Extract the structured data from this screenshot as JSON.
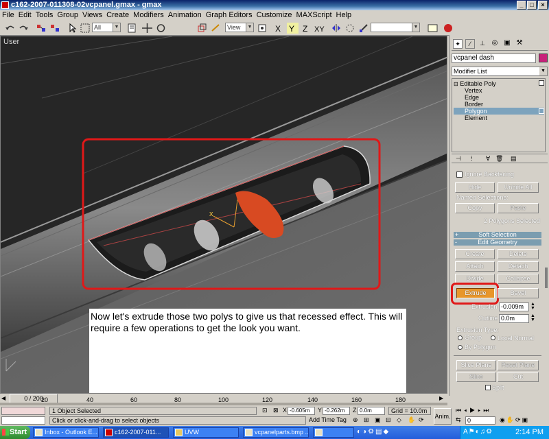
{
  "window": {
    "title": "c162-2007-011308-02vcpanel.gmax - gmax",
    "buttons": [
      "_",
      "□",
      "×"
    ]
  },
  "menu": [
    "File",
    "Edit",
    "Tools",
    "Group",
    "Views",
    "Create",
    "Modifiers",
    "Animation",
    "Graph Editors",
    "Customize",
    "MAXScript",
    "Help"
  ],
  "toolbar": {
    "selection_filter": "All",
    "reference_coord": "View"
  },
  "viewport": {
    "label": "User",
    "caption": "Now let's extrude those two polys to give us that recessed effect.  This will require a few operations to get the look you want.",
    "highlight_color": "#e01818"
  },
  "command_panel": {
    "object_name": "vcpanel dash",
    "object_color": "#c8207a",
    "modifier_list": "Modifier List",
    "stack": {
      "root": "Editable Poly",
      "items": [
        "Vertex",
        "Edge",
        "Border",
        "Polygon",
        "Element"
      ],
      "selected": "Polygon"
    },
    "ignore_backfacing": "Ignore Backfacing",
    "hide": "Hide",
    "unhide_all": "Unhide All",
    "named_selections": "Named Selections:",
    "copy": "Copy",
    "paste": "Paste",
    "selection_status": "2 Polygons Selected",
    "soft_selection": "Soft Selection",
    "edit_geometry": "Edit Geometry",
    "create": "Create",
    "delete": "Delete",
    "attach": "Attach",
    "detach": "Detach",
    "divide": "Divide",
    "collapse": "Collapse",
    "extrude": "Extrude",
    "bevel": "Bevel",
    "extrusion_label": "Extrusion",
    "extrusion_value": "-0.009m",
    "outline_label": "Outline",
    "outline_value": "0.0m",
    "extrusion_type": "Extrusion Type:",
    "group": "Group",
    "local_normal": "Local Normal",
    "by_polygon": "By Polygon",
    "slice_plane": "Slice Plane",
    "reset_plane": "Reset Plane",
    "slice": "Slice",
    "cut": "Cut",
    "split": "Split",
    "extrude_active_color": "#e8962a"
  },
  "timeline": {
    "frame": "0 / 200",
    "ticks": [
      "20",
      "40",
      "60",
      "80",
      "100",
      "120",
      "140",
      "160",
      "180"
    ]
  },
  "status": {
    "objects_selected": "1 Object Selected",
    "prompt": "Click or click-and-drag to select objects",
    "x_label": "X",
    "x_value": "-0.605m",
    "y_label": "Y",
    "y_value": "-0.262m",
    "z_label": "Z",
    "z_value": "0.0m",
    "grid": "Grid = 10.0m",
    "add_time_tag": "Add Time Tag",
    "anim": "Anim.",
    "frame_field": "0"
  },
  "taskbar": {
    "start": "Start",
    "tasks": [
      "Inbox - Outlook E...",
      "c162-2007-011...",
      "UVW",
      "vcpanelparts.bmp ...",
      ""
    ],
    "active_task": 1,
    "clock": "2:14 PM"
  }
}
